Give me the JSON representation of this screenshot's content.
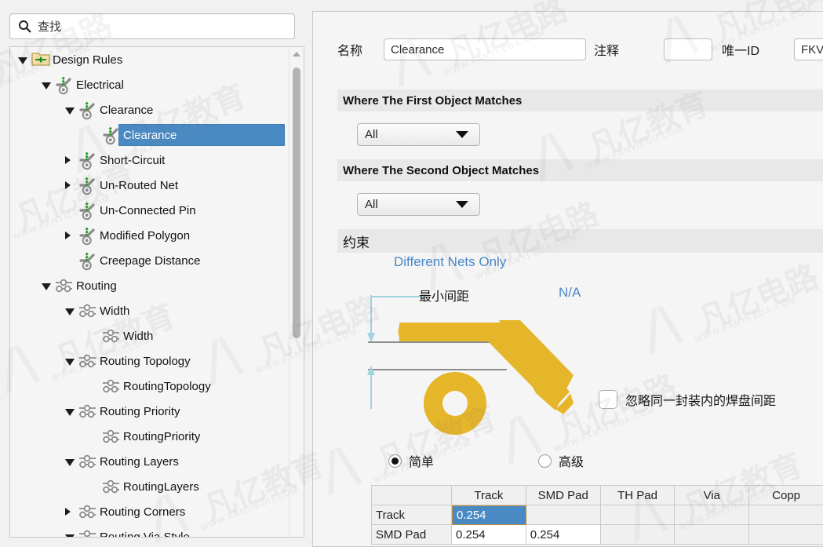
{
  "search": {
    "placeholder": "查找",
    "value": "",
    "icon": "search-icon"
  },
  "tree": {
    "nodes": [
      {
        "label": "Design Rules",
        "depth": 0,
        "twisty": "open",
        "icon": "folder-rules-icon",
        "selected": false
      },
      {
        "label": "Electrical",
        "depth": 1,
        "twisty": "open",
        "icon": "electrical-rule-icon",
        "selected": false
      },
      {
        "label": "Clearance",
        "depth": 2,
        "twisty": "open",
        "icon": "electrical-rule-icon",
        "selected": false
      },
      {
        "label": "Clearance",
        "depth": 3,
        "twisty": "none",
        "icon": "electrical-rule-icon",
        "selected": true
      },
      {
        "label": "Short-Circuit",
        "depth": 2,
        "twisty": "closed",
        "icon": "electrical-rule-icon",
        "selected": false
      },
      {
        "label": "Un-Routed Net",
        "depth": 2,
        "twisty": "closed",
        "icon": "electrical-rule-icon",
        "selected": false
      },
      {
        "label": "Un-Connected Pin",
        "depth": 2,
        "twisty": "none",
        "icon": "electrical-rule-icon",
        "selected": false
      },
      {
        "label": "Modified Polygon",
        "depth": 2,
        "twisty": "closed",
        "icon": "electrical-rule-icon",
        "selected": false
      },
      {
        "label": "Creepage Distance",
        "depth": 2,
        "twisty": "none",
        "icon": "electrical-rule-icon",
        "selected": false
      },
      {
        "label": "Routing",
        "depth": 1,
        "twisty": "open",
        "icon": "routing-rule-icon",
        "selected": false
      },
      {
        "label": "Width",
        "depth": 2,
        "twisty": "open",
        "icon": "routing-rule-icon",
        "selected": false
      },
      {
        "label": "Width",
        "depth": 3,
        "twisty": "none",
        "icon": "routing-rule-icon",
        "selected": false
      },
      {
        "label": "Routing Topology",
        "depth": 2,
        "twisty": "open",
        "icon": "routing-rule-icon",
        "selected": false
      },
      {
        "label": "RoutingTopology",
        "depth": 3,
        "twisty": "none",
        "icon": "routing-rule-icon",
        "selected": false
      },
      {
        "label": "Routing Priority",
        "depth": 2,
        "twisty": "open",
        "icon": "routing-rule-icon",
        "selected": false
      },
      {
        "label": "RoutingPriority",
        "depth": 3,
        "twisty": "none",
        "icon": "routing-rule-icon",
        "selected": false
      },
      {
        "label": "Routing Layers",
        "depth": 2,
        "twisty": "open",
        "icon": "routing-rule-icon",
        "selected": false
      },
      {
        "label": "RoutingLayers",
        "depth": 3,
        "twisty": "none",
        "icon": "routing-rule-icon",
        "selected": false
      },
      {
        "label": "Routing Corners",
        "depth": 2,
        "twisty": "closed",
        "icon": "routing-rule-icon",
        "selected": false
      },
      {
        "label": "Routing Via Style",
        "depth": 2,
        "twisty": "open",
        "icon": "routing-rule-icon",
        "selected": false
      }
    ]
  },
  "rule": {
    "name_label": "名称",
    "name_value": "Clearance",
    "comment_label": "注释",
    "comment_value": "",
    "uid_label": "唯一ID",
    "uid_value": "FKV"
  },
  "sections": {
    "first_match_title": "Where The First Object Matches",
    "first_match_value": "All",
    "second_match_title": "Where The Second Object Matches",
    "second_match_value": "All",
    "constraints_title": "约束"
  },
  "diagram": {
    "nets_only": "Different Nets Only",
    "min_clearance": "最小间距",
    "na": "N/A",
    "copper_color": "#e5b52a",
    "accent_blue": "#4a87c8",
    "dim_line_color": "#9fd3dd"
  },
  "options": {
    "ignore_pad_checkbox": "忽略同一封装内的焊盘间距",
    "ignore_pad_checked": false,
    "mode_simple": "简单",
    "mode_advanced": "高级",
    "mode_selected": "简单"
  },
  "table": {
    "corner": "",
    "columns": [
      "Track",
      "SMD Pad",
      "TH Pad",
      "Via",
      "Copp"
    ],
    "rows": [
      {
        "header": "Track",
        "values": [
          "0.254",
          "",
          "",
          "",
          ""
        ]
      },
      {
        "header": "SMD Pad",
        "values": [
          "0.254",
          "0.254",
          "",
          "",
          ""
        ]
      }
    ],
    "selected_cell": {
      "row": 0,
      "col": 0
    },
    "selection_color": "#4a8ac4"
  },
  "watermarks": {
    "brand_cn": "凡亿电路",
    "brand_edu": "凡亿教育",
    "url_eda": "WWW.FANYI-EDA.COM",
    "url_edu": "WWW.FANYIEDU.COM"
  }
}
